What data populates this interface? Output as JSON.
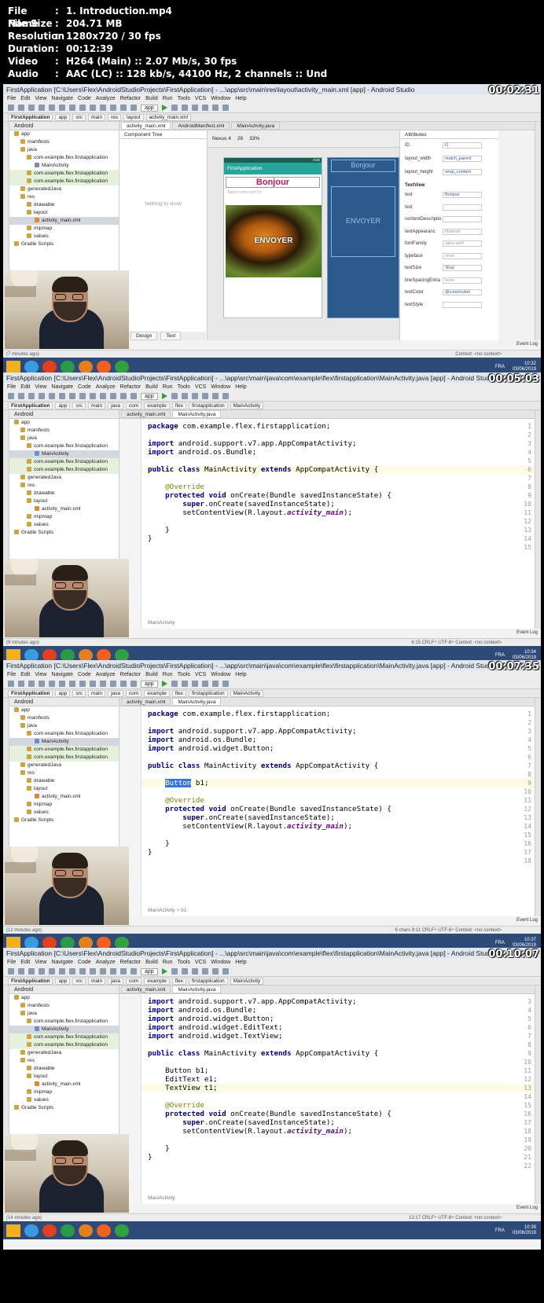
{
  "info": {
    "rows": [
      {
        "key": "File Name",
        "value": "1. Introduction.mp4"
      },
      {
        "key": "File Size",
        "value": "204.71 MB"
      },
      {
        "key": "Resolution",
        "value": "1280x720 / 30 fps"
      },
      {
        "key": "Duration",
        "value": "00:12:39"
      },
      {
        "key": "Video",
        "value": "H264 (Main) :: 2.07 Mb/s, 30 fps"
      },
      {
        "key": "Audio",
        "value": "AAC (LC) :: 128 kb/s, 44100 Hz, 2 channels :: Und"
      }
    ]
  },
  "menu": [
    "File",
    "Edit",
    "View",
    "Navigate",
    "Code",
    "Analyze",
    "Refactor",
    "Build",
    "Run",
    "Tools",
    "VCS",
    "Window",
    "Help"
  ],
  "toolbar": {
    "app_config": "app"
  },
  "project_panel": {
    "title": "Android"
  },
  "tree": [
    {
      "label": "app",
      "indent": 6,
      "icon": "folder"
    },
    {
      "label": "manifests",
      "indent": 14,
      "icon": "folder"
    },
    {
      "label": "java",
      "indent": 14,
      "icon": "folder"
    },
    {
      "label": "com.example.flex.firstapplication",
      "indent": 22,
      "icon": "folder"
    },
    {
      "label": "MainActivity",
      "indent": 32,
      "icon": "file"
    },
    {
      "label": "com.example.flex.firstapplication",
      "indent": 22,
      "icon": "folder",
      "hl": true
    },
    {
      "label": "com.example.flex.firstapplication",
      "indent": 22,
      "icon": "folder",
      "hl": true
    },
    {
      "label": "generatedJava",
      "indent": 14,
      "icon": "folder"
    },
    {
      "label": "res",
      "indent": 14,
      "icon": "folder"
    },
    {
      "label": "drawable",
      "indent": 22,
      "icon": "folder"
    },
    {
      "label": "layout",
      "indent": 22,
      "icon": "folder"
    },
    {
      "label": "activity_main.xml",
      "indent": 32,
      "icon": "xml"
    },
    {
      "label": "mipmap",
      "indent": 22,
      "icon": "folder"
    },
    {
      "label": "values",
      "indent": 22,
      "icon": "folder"
    },
    {
      "label": "Gradle Scripts",
      "indent": 6,
      "icon": "folder"
    }
  ],
  "frames": [
    {
      "timestamp": "00:02:31",
      "title": "FirstApplication [C:\\Users\\Flex\\AndroidStudioProjects\\FirstApplication] - ...\\app\\src\\main\\res\\layout\\activity_main.xml [app] - Android Studio",
      "crumbs": [
        "FirstApplication",
        "app",
        "src",
        "main",
        "res",
        "layout",
        "activity_main.xml"
      ],
      "tabs": [
        "activity_main.xml",
        "AndroidManifest.xml",
        "MainActivity.java"
      ],
      "active_tab": 0,
      "selected_tree": 11,
      "status_left": "(7 minutes ago)",
      "status_right": "Context: <no context>",
      "taskbar_time": "10:32",
      "taskbar_date": "03/06/2019",
      "lang": "FRA"
    },
    {
      "timestamp": "00:05:03",
      "title": "FirstApplication [C:\\Users\\Flex\\AndroidStudioProjects\\FirstApplication] - ...\\app\\src\\main\\java\\com\\example\\flex\\firstapplication\\MainActivity.java [app] - Android Studio",
      "crumbs": [
        "FirstApplication",
        "app",
        "src",
        "main",
        "java",
        "com",
        "example",
        "flex",
        "firstapplication",
        "MainActivity"
      ],
      "tabs": [
        "activity_main.xml",
        "MainActivity.java"
      ],
      "active_tab": 1,
      "selected_tree": 4,
      "breadcrumb": "MainActivity",
      "status_left": "(9 minutes ago)",
      "status_right": "6:15  CRLF÷  UTF-8÷  Context: <no context>",
      "taskbar_time": "10:34",
      "taskbar_date": "03/06/2019",
      "lang": "FRA"
    },
    {
      "timestamp": "00:07:35",
      "title": "FirstApplication [C:\\Users\\Flex\\AndroidStudioProjects\\FirstApplication] - ...\\app\\src\\main\\java\\com\\example\\flex\\firstapplication\\MainActivity.java [app] - Android Studio",
      "crumbs": [
        "FirstApplication",
        "app",
        "src",
        "main",
        "java",
        "com",
        "example",
        "flex",
        "firstapplication",
        "MainActivity"
      ],
      "tabs": [
        "activity_main.xml",
        "MainActivity.java"
      ],
      "active_tab": 1,
      "selected_tree": 4,
      "breadcrumb": "MainActivity  >  b1",
      "status_left": "(12 minutes ago)",
      "status_right": "6 chars   9:11  CRLF÷  UTF-8÷  Context: <no context>",
      "taskbar_time": "10:37",
      "taskbar_date": "03/06/2019",
      "lang": "FRA"
    },
    {
      "timestamp": "00:10:07",
      "title": "FirstApplication [C:\\Users\\Flex\\AndroidStudioProjects\\FirstApplication] - ...\\app\\src\\main\\java\\com\\example\\flex\\firstapplication\\MainActivity.java [app] - Android Studio",
      "crumbs": [
        "FirstApplication",
        "app",
        "src",
        "main",
        "java",
        "com",
        "example",
        "flex",
        "firstapplication",
        "MainActivity"
      ],
      "tabs": [
        "activity_main.xml",
        "MainActivity.java"
      ],
      "active_tab": 1,
      "selected_tree": 4,
      "breadcrumb": "MainActivity",
      "status_left": "(14 minutes ago)",
      "status_right": "13:17  CRLF÷  UTF-8÷  Context: <no context>",
      "taskbar_time": "10:39",
      "taskbar_date": "03/06/2019",
      "lang": "FRA"
    }
  ],
  "layout_editor": {
    "component_tree": "Component Tree",
    "nothing": "Nothing to show",
    "device": "Nexus 4",
    "api": "28",
    "zoom": "33%",
    "app_title": "FirstApplication",
    "phone_time": "8:00",
    "bonjour": "Bonjour",
    "hint": "Tapez votre nom ici",
    "envoyer": "ENVOYER",
    "bp_bonjour": "Bonjour",
    "bp_envoyer": "ENVOYER",
    "design_tab": "Design",
    "text_tab": "Text",
    "attributes_title": "Attributes",
    "attributes": [
      {
        "name": "ID",
        "value": "t1"
      },
      {
        "name": "layout_width",
        "value": "match_parent"
      },
      {
        "name": "layout_height",
        "value": "wrap_content"
      },
      {
        "name": "text",
        "value": "Bonjour"
      },
      {
        "name": "text",
        "value": ""
      },
      {
        "name": "contentDescriptio",
        "value": ""
      },
      {
        "name": "textAppearanc",
        "value": "Material"
      },
      {
        "name": "fontFamily",
        "value": "sans-serif"
      },
      {
        "name": "typeface",
        "value": "none"
      },
      {
        "name": "textSize",
        "value": "36sp"
      },
      {
        "name": "lineSpacingExtra",
        "value": "none"
      },
      {
        "name": "textColor",
        "value": "@color/colorI"
      },
      {
        "name": "textStyle",
        "value": ""
      }
    ],
    "textview_section": "TextView"
  },
  "code": [
    {
      "first_line": 1,
      "caret": 6,
      "lines": [
        "package com.example.flex.firstapplication;",
        "",
        "import android.support.v7.app.AppCompatActivity;",
        "import android.os.Bundle;",
        "",
        "public class MainActivity extends AppCompatActivity {",
        "",
        "    @Override",
        "    protected void onCreate(Bundle savedInstanceState) {",
        "        super.onCreate(savedInstanceState);",
        "        setContentView(R.layout.activity_main);",
        "",
        "    }",
        "}",
        ""
      ]
    },
    {
      "first_line": 1,
      "caret": 9,
      "lines": [
        "package com.example.flex.firstapplication;",
        "",
        "import android.support.v7.app.AppCompatActivity;",
        "import android.os.Bundle;",
        "import android.widget.Button;",
        "",
        "public class MainActivity extends AppCompatActivity {",
        "",
        "    Button b1;",
        "",
        "    @Override",
        "    protected void onCreate(Bundle savedInstanceState) {",
        "        super.onCreate(savedInstanceState);",
        "        setContentView(R.layout.activity_main);",
        "",
        "    }",
        "}",
        ""
      ]
    },
    {
      "first_line": 3,
      "caret": 13,
      "lines": [
        "import android.support.v7.app.AppCompatActivity;",
        "import android.os.Bundle;",
        "import android.widget.Button;",
        "import android.widget.EditText;",
        "import android.widget.TextView;",
        "",
        "public class MainActivity extends AppCompatActivity {",
        "",
        "    Button b1;",
        "    EditText e1;",
        "    TextView t1;",
        "",
        "    @Override",
        "    protected void onCreate(Bundle savedInstanceState) {",
        "        super.onCreate(savedInstanceState);",
        "        setContentView(R.layout.activity_main);",
        "",
        "    }",
        "}",
        ""
      ]
    }
  ],
  "event_log": "Event Log",
  "colors": {
    "accent": "#26a69a",
    "keyword": "#000080",
    "annotation": "#808000",
    "taskbar": "#2e4a78"
  }
}
